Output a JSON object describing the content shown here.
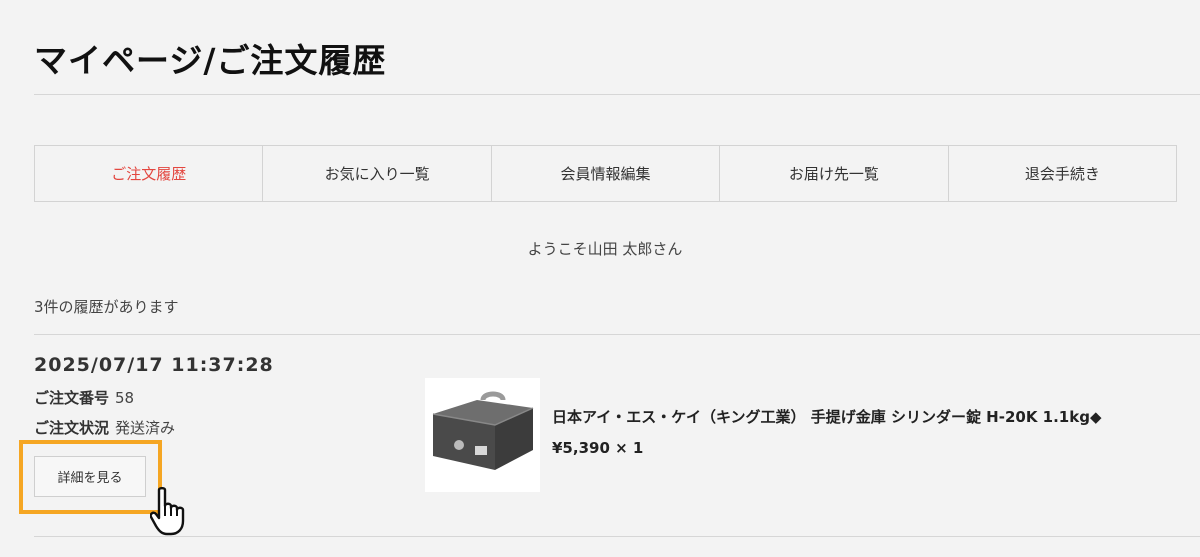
{
  "page_title": "マイページ/ご注文履歴",
  "tabs": [
    {
      "label": "ご注文履歴",
      "active": true
    },
    {
      "label": "お気に入り一覧"
    },
    {
      "label": "会員情報編集"
    },
    {
      "label": "お届け先一覧"
    },
    {
      "label": "退会手続き"
    }
  ],
  "welcome": "ようこそ山田 太郎さん",
  "history_count": "3件の履歴があります",
  "order": {
    "datetime": "2025/07/17 11:37:28",
    "number_label": "ご注文番号",
    "number": "58",
    "status_label": "ご注文状況",
    "status": "発送済み",
    "detail_button": "詳細を見る",
    "product_name": "日本アイ・エス・ケイ（キング工業） 手提げ金庫 シリンダー錠 H-20K 1.1kg◆",
    "product_price": "¥5,390 × 1",
    "product_image": "cash-box-image"
  },
  "colors": {
    "active_tab": "#e3463f",
    "highlight": "#f5a623",
    "background": "#f3f3f3"
  },
  "icons": [
    "pointing-hand-cursor-icon"
  ]
}
